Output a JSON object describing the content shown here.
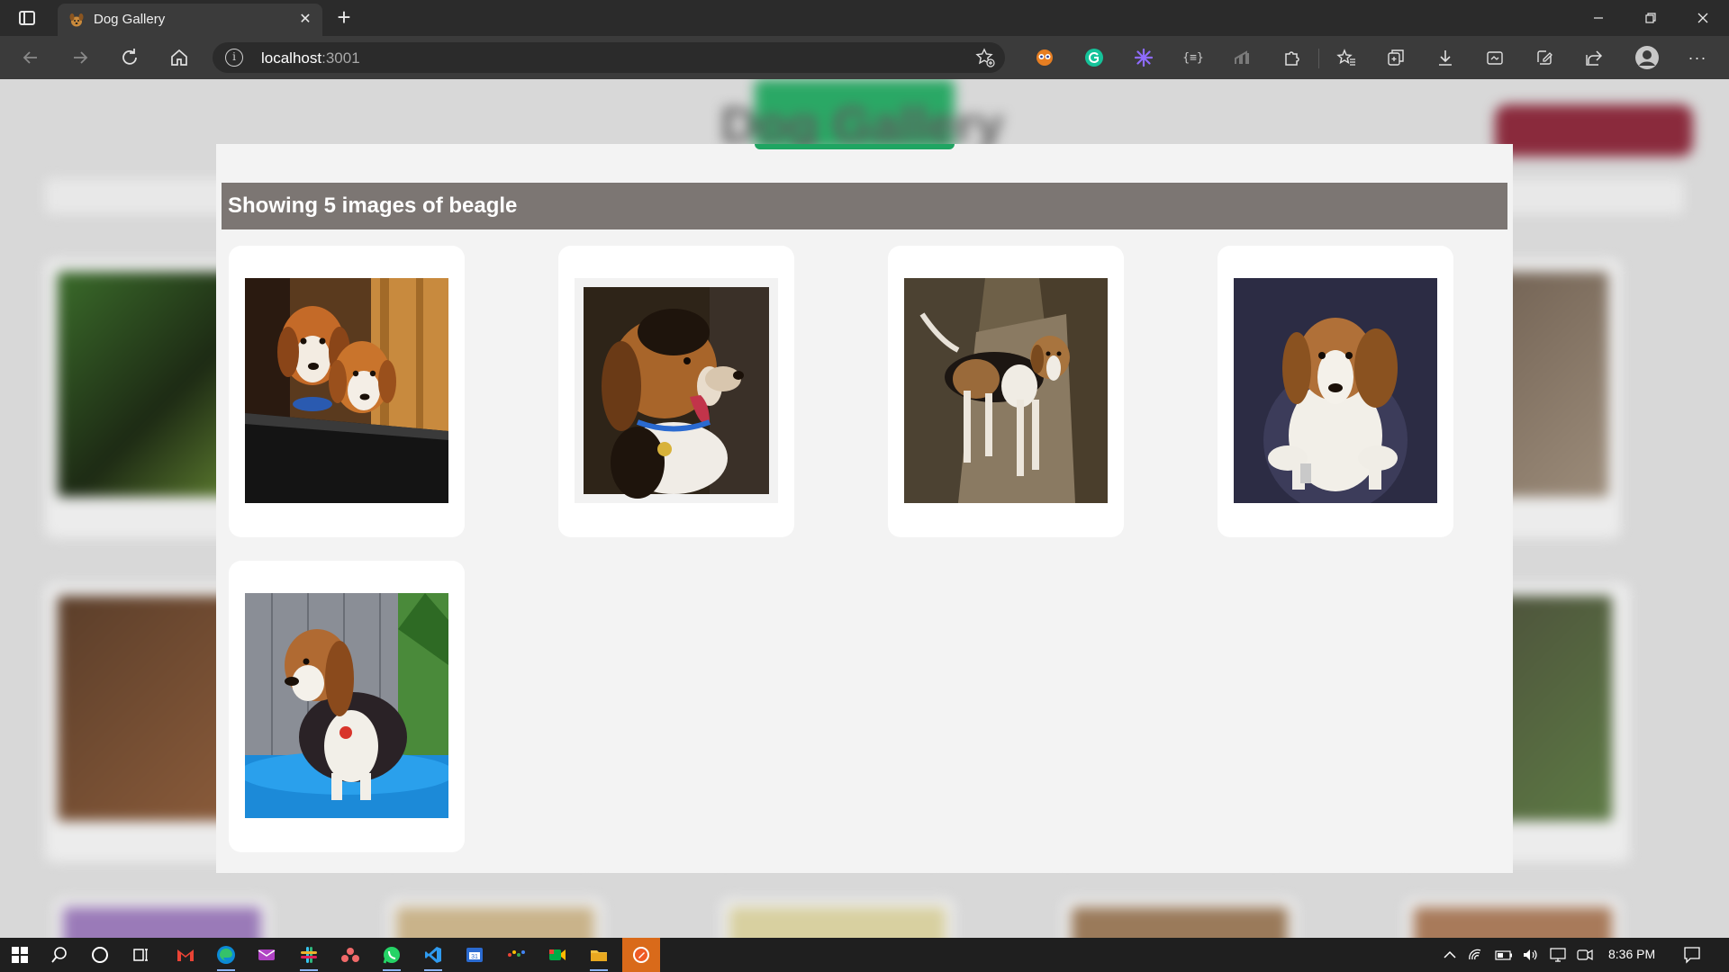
{
  "browser": {
    "tab_title": "Dog Gallery",
    "url_host": "localhost",
    "url_port": ":3001"
  },
  "page": {
    "background_title": "Dog Gallery",
    "results_text": "Showing 5 images of beagle",
    "breed": "beagle",
    "image_count": 5
  },
  "images": [
    {
      "name": "beagle-photo-1"
    },
    {
      "name": "beagle-photo-2"
    },
    {
      "name": "beagle-photo-3"
    },
    {
      "name": "beagle-photo-4"
    },
    {
      "name": "beagle-photo-5"
    }
  ],
  "taskbar": {
    "time": "8:36 PM"
  },
  "colors": {
    "results_bar": "#7c7673",
    "accent_green": "#1fa562",
    "background_button": "#8a2a3c"
  }
}
